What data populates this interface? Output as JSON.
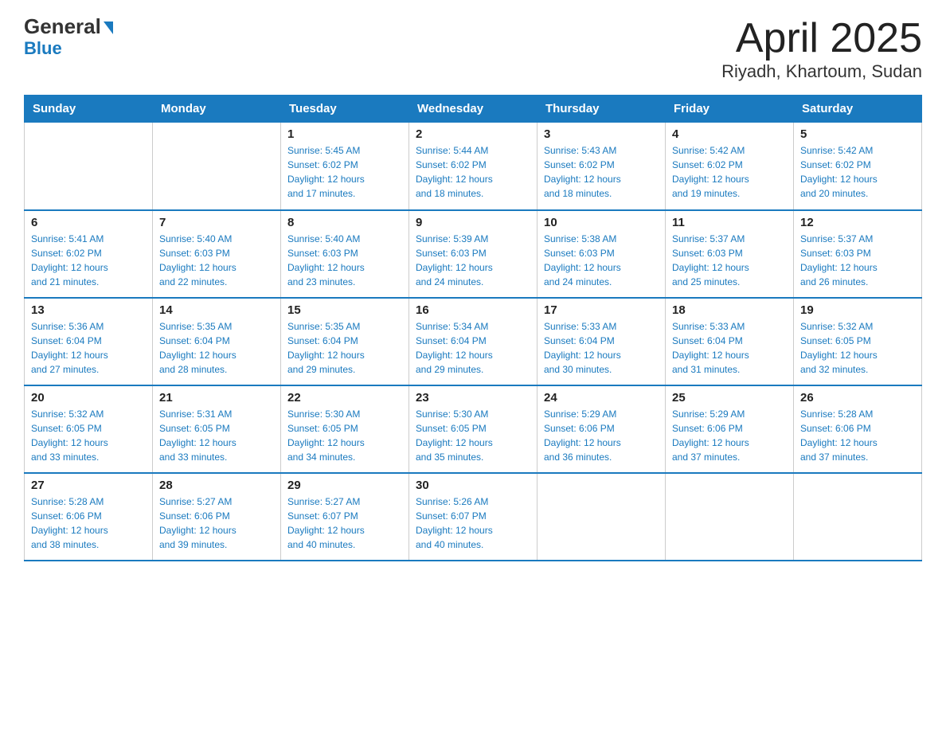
{
  "header": {
    "logo_line1": "General",
    "logo_line2": "Blue",
    "title": "April 2025",
    "subtitle": "Riyadh, Khartoum, Sudan"
  },
  "calendar": {
    "days_of_week": [
      "Sunday",
      "Monday",
      "Tuesday",
      "Wednesday",
      "Thursday",
      "Friday",
      "Saturday"
    ],
    "weeks": [
      [
        {
          "day": "",
          "info": ""
        },
        {
          "day": "",
          "info": ""
        },
        {
          "day": "1",
          "info": "Sunrise: 5:45 AM\nSunset: 6:02 PM\nDaylight: 12 hours\nand 17 minutes."
        },
        {
          "day": "2",
          "info": "Sunrise: 5:44 AM\nSunset: 6:02 PM\nDaylight: 12 hours\nand 18 minutes."
        },
        {
          "day": "3",
          "info": "Sunrise: 5:43 AM\nSunset: 6:02 PM\nDaylight: 12 hours\nand 18 minutes."
        },
        {
          "day": "4",
          "info": "Sunrise: 5:42 AM\nSunset: 6:02 PM\nDaylight: 12 hours\nand 19 minutes."
        },
        {
          "day": "5",
          "info": "Sunrise: 5:42 AM\nSunset: 6:02 PM\nDaylight: 12 hours\nand 20 minutes."
        }
      ],
      [
        {
          "day": "6",
          "info": "Sunrise: 5:41 AM\nSunset: 6:02 PM\nDaylight: 12 hours\nand 21 minutes."
        },
        {
          "day": "7",
          "info": "Sunrise: 5:40 AM\nSunset: 6:03 PM\nDaylight: 12 hours\nand 22 minutes."
        },
        {
          "day": "8",
          "info": "Sunrise: 5:40 AM\nSunset: 6:03 PM\nDaylight: 12 hours\nand 23 minutes."
        },
        {
          "day": "9",
          "info": "Sunrise: 5:39 AM\nSunset: 6:03 PM\nDaylight: 12 hours\nand 24 minutes."
        },
        {
          "day": "10",
          "info": "Sunrise: 5:38 AM\nSunset: 6:03 PM\nDaylight: 12 hours\nand 24 minutes."
        },
        {
          "day": "11",
          "info": "Sunrise: 5:37 AM\nSunset: 6:03 PM\nDaylight: 12 hours\nand 25 minutes."
        },
        {
          "day": "12",
          "info": "Sunrise: 5:37 AM\nSunset: 6:03 PM\nDaylight: 12 hours\nand 26 minutes."
        }
      ],
      [
        {
          "day": "13",
          "info": "Sunrise: 5:36 AM\nSunset: 6:04 PM\nDaylight: 12 hours\nand 27 minutes."
        },
        {
          "day": "14",
          "info": "Sunrise: 5:35 AM\nSunset: 6:04 PM\nDaylight: 12 hours\nand 28 minutes."
        },
        {
          "day": "15",
          "info": "Sunrise: 5:35 AM\nSunset: 6:04 PM\nDaylight: 12 hours\nand 29 minutes."
        },
        {
          "day": "16",
          "info": "Sunrise: 5:34 AM\nSunset: 6:04 PM\nDaylight: 12 hours\nand 29 minutes."
        },
        {
          "day": "17",
          "info": "Sunrise: 5:33 AM\nSunset: 6:04 PM\nDaylight: 12 hours\nand 30 minutes."
        },
        {
          "day": "18",
          "info": "Sunrise: 5:33 AM\nSunset: 6:04 PM\nDaylight: 12 hours\nand 31 minutes."
        },
        {
          "day": "19",
          "info": "Sunrise: 5:32 AM\nSunset: 6:05 PM\nDaylight: 12 hours\nand 32 minutes."
        }
      ],
      [
        {
          "day": "20",
          "info": "Sunrise: 5:32 AM\nSunset: 6:05 PM\nDaylight: 12 hours\nand 33 minutes."
        },
        {
          "day": "21",
          "info": "Sunrise: 5:31 AM\nSunset: 6:05 PM\nDaylight: 12 hours\nand 33 minutes."
        },
        {
          "day": "22",
          "info": "Sunrise: 5:30 AM\nSunset: 6:05 PM\nDaylight: 12 hours\nand 34 minutes."
        },
        {
          "day": "23",
          "info": "Sunrise: 5:30 AM\nSunset: 6:05 PM\nDaylight: 12 hours\nand 35 minutes."
        },
        {
          "day": "24",
          "info": "Sunrise: 5:29 AM\nSunset: 6:06 PM\nDaylight: 12 hours\nand 36 minutes."
        },
        {
          "day": "25",
          "info": "Sunrise: 5:29 AM\nSunset: 6:06 PM\nDaylight: 12 hours\nand 37 minutes."
        },
        {
          "day": "26",
          "info": "Sunrise: 5:28 AM\nSunset: 6:06 PM\nDaylight: 12 hours\nand 37 minutes."
        }
      ],
      [
        {
          "day": "27",
          "info": "Sunrise: 5:28 AM\nSunset: 6:06 PM\nDaylight: 12 hours\nand 38 minutes."
        },
        {
          "day": "28",
          "info": "Sunrise: 5:27 AM\nSunset: 6:06 PM\nDaylight: 12 hours\nand 39 minutes."
        },
        {
          "day": "29",
          "info": "Sunrise: 5:27 AM\nSunset: 6:07 PM\nDaylight: 12 hours\nand 40 minutes."
        },
        {
          "day": "30",
          "info": "Sunrise: 5:26 AM\nSunset: 6:07 PM\nDaylight: 12 hours\nand 40 minutes."
        },
        {
          "day": "",
          "info": ""
        },
        {
          "day": "",
          "info": ""
        },
        {
          "day": "",
          "info": ""
        }
      ]
    ]
  }
}
